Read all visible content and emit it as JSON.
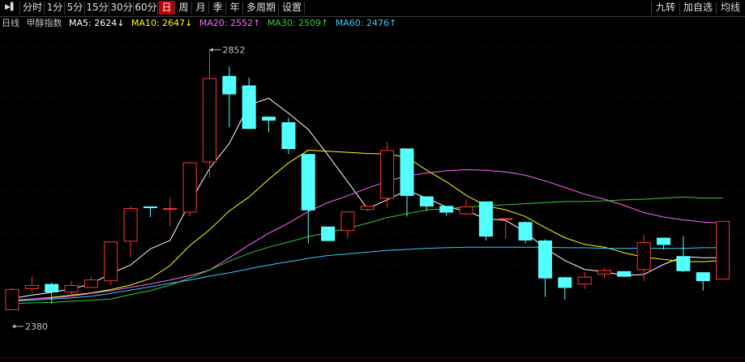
{
  "toolbar": {
    "left": [
      {
        "label": "▶▌",
        "name": "toggle-panel-button"
      },
      {
        "label": "分时",
        "name": "tab-fenshi"
      },
      {
        "label": "1分",
        "name": "tab-1min"
      },
      {
        "label": "5分",
        "name": "tab-5min"
      },
      {
        "label": "15分",
        "name": "tab-15min"
      },
      {
        "label": "30分",
        "name": "tab-30min"
      },
      {
        "label": "60分",
        "name": "tab-60min"
      },
      {
        "label": "日",
        "name": "tab-day",
        "active": true
      },
      {
        "label": "周",
        "name": "tab-week"
      },
      {
        "label": "月",
        "name": "tab-month"
      },
      {
        "label": "季",
        "name": "tab-season"
      },
      {
        "label": "年",
        "name": "tab-year"
      },
      {
        "label": "多周期",
        "name": "tab-multi-period"
      },
      {
        "label": "设置",
        "name": "settings-button"
      }
    ],
    "right": [
      {
        "label": "九转",
        "name": "jiuzhuan-button"
      },
      {
        "label": "加自选",
        "name": "add-watchlist-button"
      },
      {
        "label": "均线",
        "name": "ma-button"
      }
    ]
  },
  "legend": {
    "period": "日线",
    "instrument": "甲醇指数",
    "items": [
      {
        "text": "MA5: 2624↓",
        "color": "#ffffff"
      },
      {
        "text": "MA10: 2647↓",
        "color": "#ffff00"
      },
      {
        "text": "MA20: 2552↑",
        "color": "#ff66ff"
      },
      {
        "text": "MA30: 2509↑",
        "color": "#33cc33"
      },
      {
        "text": "MA60: 2476↑",
        "color": "#33ccff"
      }
    ]
  },
  "colors": {
    "up": "#ff3232",
    "down": "#54ffff",
    "grid": "#5a0000",
    "label": "#c0c0c0"
  },
  "chart_data": {
    "type": "candlestick",
    "ylim": [
      2380,
      2852
    ],
    "max_label": "2852",
    "min_label": "2380",
    "candles": [
      {
        "o": 2380,
        "h": 2420,
        "l": 2380,
        "c": 2418
      },
      {
        "o": 2418,
        "h": 2440,
        "l": 2412,
        "c": 2425
      },
      {
        "o": 2427,
        "h": 2430,
        "l": 2392,
        "c": 2412
      },
      {
        "o": 2412,
        "h": 2432,
        "l": 2405,
        "c": 2425
      },
      {
        "o": 2420,
        "h": 2440,
        "l": 2420,
        "c": 2435
      },
      {
        "o": 2432,
        "h": 2500,
        "l": 2425,
        "c": 2503
      },
      {
        "o": 2503,
        "h": 2567,
        "l": 2476,
        "c": 2563
      },
      {
        "o": 2566,
        "h": 2566,
        "l": 2547,
        "c": 2563
      },
      {
        "o": 2561,
        "h": 2582,
        "l": 2530,
        "c": 2563
      },
      {
        "o": 2555,
        "h": 2647,
        "l": 2548,
        "c": 2645
      },
      {
        "o": 2645,
        "h": 2847,
        "l": 2618,
        "c": 2796
      },
      {
        "o": 2800,
        "h": 2817,
        "l": 2708,
        "c": 2767
      },
      {
        "o": 2783,
        "h": 2797,
        "l": 2725,
        "c": 2705
      },
      {
        "o": 2727,
        "h": 2717,
        "l": 2699,
        "c": 2720
      },
      {
        "o": 2717,
        "h": 2725,
        "l": 2660,
        "c": 2669
      },
      {
        "o": 2660,
        "h": 2660,
        "l": 2500,
        "c": 2559
      },
      {
        "o": 2530,
        "h": 2530,
        "l": 2505,
        "c": 2504
      },
      {
        "o": 2522,
        "h": 2557,
        "l": 2509,
        "c": 2557
      },
      {
        "o": 2560,
        "h": 2567,
        "l": 2557,
        "c": 2567
      },
      {
        "o": 2580,
        "h": 2681,
        "l": 2564,
        "c": 2667
      },
      {
        "o": 2670,
        "h": 2670,
        "l": 2548,
        "c": 2585
      },
      {
        "o": 2584,
        "h": 2577,
        "l": 2558,
        "c": 2566
      },
      {
        "o": 2567,
        "h": 2567,
        "l": 2549,
        "c": 2555
      },
      {
        "o": 2552,
        "h": 2579,
        "l": 2551,
        "c": 2566
      },
      {
        "o": 2575,
        "h": 2575,
        "l": 2505,
        "c": 2512
      },
      {
        "o": 2542,
        "h": 2544,
        "l": 2508,
        "c": 2545
      },
      {
        "o": 2538,
        "h": 2539,
        "l": 2500,
        "c": 2505
      },
      {
        "o": 2505,
        "h": 2507,
        "l": 2404,
        "c": 2437
      },
      {
        "o": 2439,
        "h": 2440,
        "l": 2399,
        "c": 2420
      },
      {
        "o": 2426,
        "h": 2449,
        "l": 2418,
        "c": 2440
      },
      {
        "o": 2444,
        "h": 2456,
        "l": 2437,
        "c": 2452
      },
      {
        "o": 2450,
        "h": 2450,
        "l": 2445,
        "c": 2440
      },
      {
        "o": 2452,
        "h": 2515,
        "l": 2432,
        "c": 2502
      },
      {
        "o": 2510,
        "h": 2510,
        "l": 2489,
        "c": 2497
      },
      {
        "o": 2477,
        "h": 2513,
        "l": 2448,
        "c": 2450
      },
      {
        "o": 2448,
        "h": 2427,
        "l": 2415,
        "c": 2432
      },
      {
        "o": 2435,
        "h": 2540,
        "l": 2435,
        "c": 2540
      }
    ],
    "ma": {
      "MA5": {
        "color": "#ffffff",
        "v": [
          2401,
          2407,
          2412,
          2418,
          2427,
          2446,
          2461,
          2490,
          2505,
          2573,
          2634,
          2679,
          2748,
          2760,
          2733,
          2704,
          2658,
          2610,
          2562,
          2578,
          2595,
          2581,
          2565,
          2558,
          2544,
          2541,
          2520,
          2491,
          2469,
          2453,
          2449,
          2442,
          2444,
          2462,
          2476,
          2474,
          2474
        ]
      },
      "MA10": {
        "color": "#ffff00",
        "v": [
          2397,
          2400,
          2403,
          2407,
          2411,
          2417,
          2425,
          2437,
          2460,
          2496,
          2524,
          2558,
          2583,
          2615,
          2644,
          2667,
          2665,
          2663,
          2661,
          2660,
          2654,
          2631,
          2610,
          2586,
          2567,
          2560,
          2548,
          2528,
          2510,
          2498,
          2493,
          2483,
          2475,
          2471,
          2467,
          2467,
          2469
        ]
      },
      "MA20": {
        "color": "#ff66ff",
        "v": [
          2398,
          2400,
          2402,
          2405,
          2410,
          2415,
          2421,
          2427,
          2434,
          2442,
          2452,
          2474,
          2497,
          2518,
          2536,
          2557,
          2573,
          2585,
          2599,
          2611,
          2621,
          2626,
          2630,
          2632,
          2631,
          2628,
          2622,
          2612,
          2600,
          2588,
          2579,
          2568,
          2555,
          2547,
          2542,
          2538,
          2536
        ]
      },
      "MA30": {
        "color": "#33cc33",
        "v": [
          2392,
          2393,
          2394,
          2396,
          2398,
          2400,
          2408,
          2415,
          2425,
          2438,
          2452,
          2468,
          2482,
          2493,
          2502,
          2512,
          2519,
          2527,
          2536,
          2546,
          2553,
          2560,
          2562,
          2565,
          2567,
          2569,
          2571,
          2573,
          2575,
          2575,
          2576,
          2578,
          2579,
          2581,
          2583,
          2581,
          2581
        ]
      },
      "MA60": {
        "color": "#33ccff",
        "v": [
          2396,
          2398,
          2400,
          2402,
          2405,
          2410,
          2416,
          2422,
          2428,
          2434,
          2441,
          2447,
          2454,
          2461,
          2467,
          2473,
          2478,
          2481,
          2484,
          2487,
          2489,
          2491,
          2492,
          2493,
          2493,
          2493,
          2493,
          2493,
          2492,
          2492,
          2491,
          2491,
          2491,
          2491,
          2491,
          2492,
          2492
        ]
      }
    }
  }
}
